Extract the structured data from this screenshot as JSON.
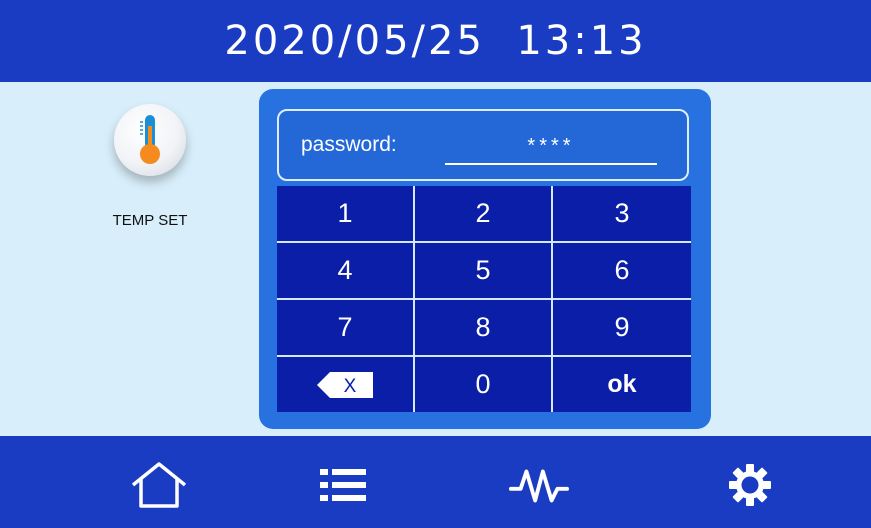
{
  "header": {
    "datetime": "2020/05/25  13:13"
  },
  "apps": [
    {
      "label": "TEMP SET",
      "icon": "thermometer-icon"
    }
  ],
  "password_dialog": {
    "label": "password:",
    "masked_value": "****",
    "keys": [
      "1",
      "2",
      "3",
      "4",
      "5",
      "6",
      "7",
      "8",
      "9",
      "backspace-icon",
      "0",
      "ok"
    ],
    "backspace_glyph": "X"
  },
  "nav": {
    "icons": [
      "home-icon",
      "list-icon",
      "waveform-icon",
      "gear-icon"
    ]
  },
  "colors": {
    "header_bg": "#1a3cc2",
    "page_bg": "#d8eefa",
    "dialog_bg": "#2771e0",
    "keypad_bg": "#0a1ea8",
    "thermo_orange": "#f58a1f",
    "thermo_blue": "#1a8fd6"
  }
}
